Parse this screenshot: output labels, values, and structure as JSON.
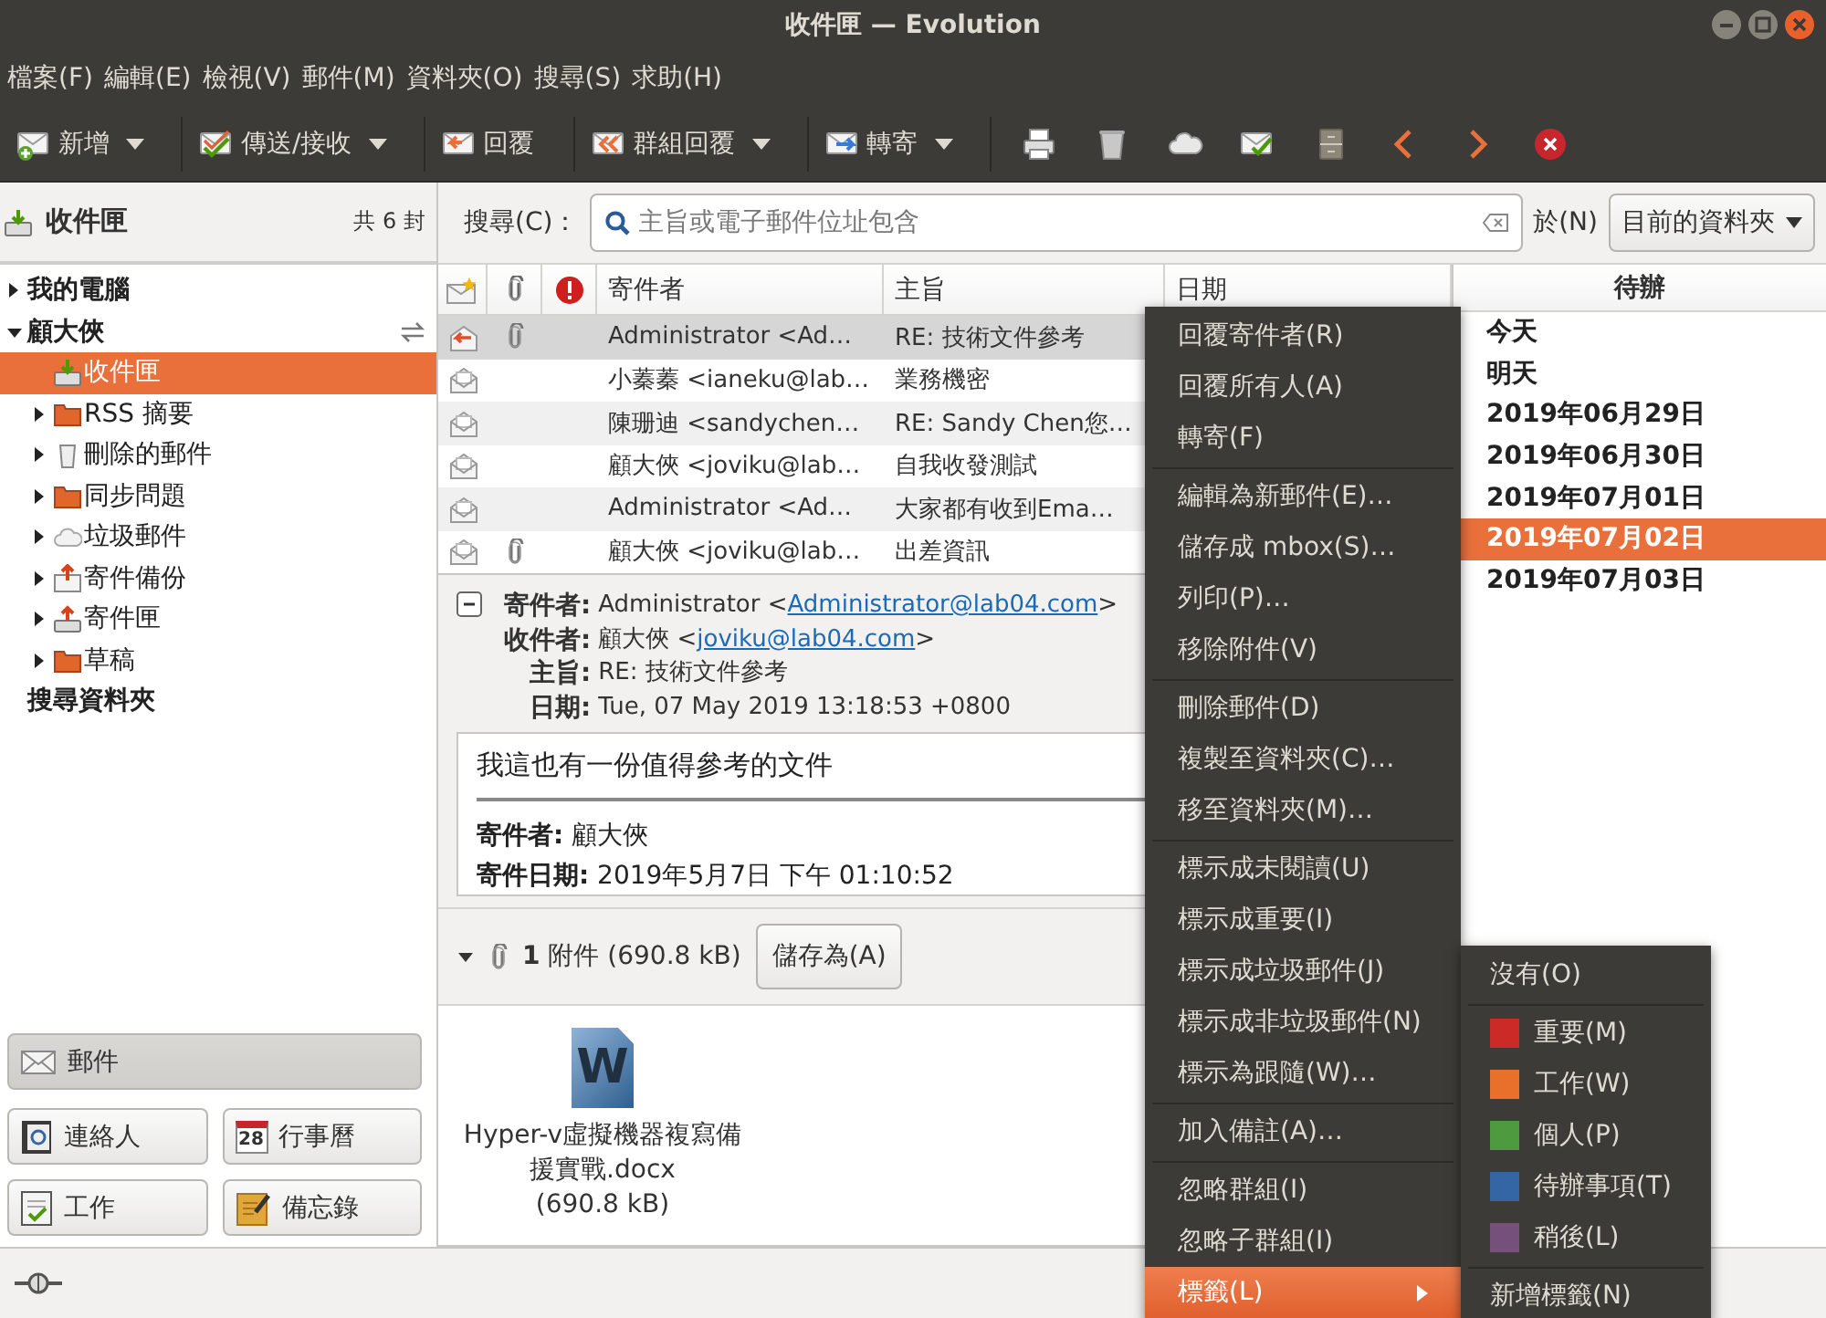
{
  "window": {
    "title": "收件匣 — Evolution"
  },
  "menu_bar": [
    "檔案(F)",
    "編輯(E)",
    "檢視(V)",
    "郵件(M)",
    "資料夾(O)",
    "搜尋(S)",
    "求助(H)"
  ],
  "toolbar": [
    {
      "kind": "new",
      "label": "新增",
      "dropdown": true
    },
    {
      "kind": "send-receive",
      "label": "傳送/接收",
      "dropdown": true
    },
    {
      "kind": "reply",
      "label": "回覆",
      "dropdown": false
    },
    {
      "kind": "reply-group",
      "label": "群組回覆",
      "dropdown": true
    },
    {
      "kind": "forward",
      "label": "轉寄",
      "dropdown": true
    },
    {
      "kind": "print"
    },
    {
      "kind": "delete"
    },
    {
      "kind": "junk"
    },
    {
      "kind": "not-junk"
    },
    {
      "kind": "archive"
    },
    {
      "kind": "previous"
    },
    {
      "kind": "next"
    },
    {
      "kind": "stop"
    }
  ],
  "sidebar": {
    "title": "收件匣",
    "count": "共 6 封",
    "tree": [
      {
        "label": "我的電腦",
        "expanded": false,
        "sync": false,
        "selected": false
      },
      {
        "label": "顧大俠",
        "expanded": true,
        "sync": true,
        "selected": false,
        "children": [
          {
            "label": "收件匣",
            "kind": "inbox",
            "selected": true
          },
          {
            "label": "RSS 摘要",
            "kind": "folder",
            "expanded": false,
            "selected": false
          },
          {
            "label": "刪除的郵件",
            "kind": "trash",
            "expanded": false,
            "selected": false
          },
          {
            "label": "同步問題",
            "kind": "folder",
            "expanded": false,
            "selected": false
          },
          {
            "label": "垃圾郵件",
            "kind": "junk",
            "expanded": false,
            "selected": false
          },
          {
            "label": "寄件備份",
            "kind": "sent",
            "expanded": false,
            "selected": false
          },
          {
            "label": "寄件匣",
            "kind": "outbox",
            "expanded": false,
            "selected": false
          },
          {
            "label": "草稿",
            "kind": "folder",
            "expanded": false,
            "selected": false
          }
        ]
      },
      {
        "label": "搜尋資料夾",
        "sync": false,
        "selected": false
      }
    ]
  },
  "switcher": [
    {
      "kind": "mail",
      "label": "郵件",
      "selected": true
    },
    {
      "kind": "contacts",
      "label": "連絡人",
      "selected": false
    },
    {
      "kind": "calendar",
      "label": "行事曆",
      "selected": false,
      "icon_text": "28"
    },
    {
      "kind": "tasks",
      "label": "工作",
      "selected": false
    },
    {
      "kind": "memos",
      "label": "備忘錄",
      "selected": false
    }
  ],
  "search": {
    "label": "搜尋(C)：",
    "placeholder": "主旨或電子郵件位址包含",
    "scope_label": "於(N)",
    "scope": "目前的資料夾"
  },
  "message_list": {
    "columns": [
      "寄件者",
      "主旨",
      "日期"
    ],
    "rows": [
      {
        "kind": "replied",
        "attachment": true,
        "sender": "Administrator <Ad…",
        "subject": "RE: 技術文件參考",
        "selected": true
      },
      {
        "kind": "read",
        "attachment": false,
        "sender": "小蓁蓁 <ianeku@lab…",
        "subject": "業務機密",
        "selected": false
      },
      {
        "kind": "read",
        "attachment": false,
        "sender": "陳珊迪 <sandychen…",
        "subject": "RE: Sandy Chen您…",
        "selected": false
      },
      {
        "kind": "read",
        "attachment": false,
        "sender": "顧大俠 <joviku@lab…",
        "subject": "自我收發測試",
        "selected": false
      },
      {
        "kind": "read",
        "attachment": false,
        "sender": "Administrator <Ad…",
        "subject": "大家都有收到Ema…",
        "selected": false
      },
      {
        "kind": "read",
        "attachment": true,
        "sender": "顧大俠 <joviku@lab…",
        "subject": "出差資訊",
        "selected": false
      }
    ]
  },
  "preview": {
    "expanded": true,
    "headers": [
      {
        "label": "寄件者:",
        "text": "Administrator <",
        "link": "Administrator@lab04.com",
        "after": ">"
      },
      {
        "label": "收件者:",
        "text": "顧大俠 <",
        "link": "joviku@lab04.com",
        "after": ">"
      },
      {
        "label": "主旨:",
        "text": "RE: 技術文件參考"
      },
      {
        "label": "日期:",
        "text": "Tue, 07 May 2019 13:18:53 +0800"
      }
    ],
    "body": {
      "lead": "我這也有一份值得參考的文件",
      "lines": [
        "**寄件者:** 顧大俠",
        "**寄件日期:** 2019年5月7日 下午 01:10:52"
      ]
    },
    "attachments": {
      "expanded": true,
      "summary": "**1** 附件 (690.8 kB)",
      "save_button": "儲存為(A)",
      "files": [
        {
          "icon_letter": "W",
          "name": "Hyper-v虛擬機器複寫備援實戰.docx",
          "size": "(690.8 kB)"
        }
      ]
    }
  },
  "todo": {
    "title": "待辦",
    "items": [
      {
        "label": "今天",
        "selected": false
      },
      {
        "label": "明天",
        "selected": false
      },
      {
        "label": "2019年06月29日",
        "selected": false
      },
      {
        "label": "2019年06月30日",
        "selected": false
      },
      {
        "label": "2019年07月01日",
        "selected": false
      },
      {
        "label": "2019年07月02日",
        "selected": true
      },
      {
        "label": "2019年07月03日",
        "selected": false
      }
    ]
  },
  "context_menu": {
    "groups": [
      [
        {
          "label": "回覆寄件者(R)",
          "selected": false,
          "submenu": false
        },
        {
          "label": "回覆所有人(A)",
          "selected": false,
          "submenu": false
        },
        {
          "label": "轉寄(F)",
          "selected": false,
          "submenu": false
        }
      ],
      [
        {
          "label": "編輯為新郵件(E)…",
          "selected": false,
          "submenu": false
        },
        {
          "label": "儲存成 mbox(S)…",
          "selected": false,
          "submenu": false
        },
        {
          "label": "列印(P)…",
          "selected": false,
          "submenu": false
        },
        {
          "label": "移除附件(V)",
          "selected": false,
          "submenu": false
        }
      ],
      [
        {
          "label": "刪除郵件(D)",
          "selected": false,
          "submenu": false
        },
        {
          "label": "複製至資料夾(C)…",
          "selected": false,
          "submenu": false
        },
        {
          "label": "移至資料夾(M)…",
          "selected": false,
          "submenu": false
        }
      ],
      [
        {
          "label": "標示成未閱讀(U)",
          "selected": false,
          "submenu": false
        },
        {
          "label": "標示成重要(I)",
          "selected": false,
          "submenu": false
        },
        {
          "label": "標示成垃圾郵件(J)",
          "selected": false,
          "submenu": false
        },
        {
          "label": "標示成非垃圾郵件(N)",
          "selected": false,
          "submenu": false
        },
        {
          "label": "標示為跟隨(W)…",
          "selected": false,
          "submenu": false
        }
      ],
      [
        {
          "label": "加入備註(A)…",
          "selected": false,
          "submenu": false
        }
      ],
      [
        {
          "label": "忽略群組(I)",
          "selected": false,
          "submenu": false
        },
        {
          "label": "忽略子群組(I)",
          "selected": false,
          "submenu": false
        },
        {
          "label": "標籤(L)",
          "selected": true,
          "submenu": true
        }
      ]
    ]
  },
  "label_submenu": {
    "groups": [
      [
        {
          "label": "沒有(O)"
        }
      ],
      [
        {
          "label": "重要(M)",
          "color": "#cc2a26"
        },
        {
          "label": "工作(W)",
          "color": "#e8702a"
        },
        {
          "label": "個人(P)",
          "color": "#4e9a3e"
        },
        {
          "label": "待辦事項(T)",
          "color": "#3465a4"
        },
        {
          "label": "稍後(L)",
          "color": "#75507b"
        }
      ],
      [
        {
          "label": "新增標籤(N)"
        }
      ]
    ]
  }
}
